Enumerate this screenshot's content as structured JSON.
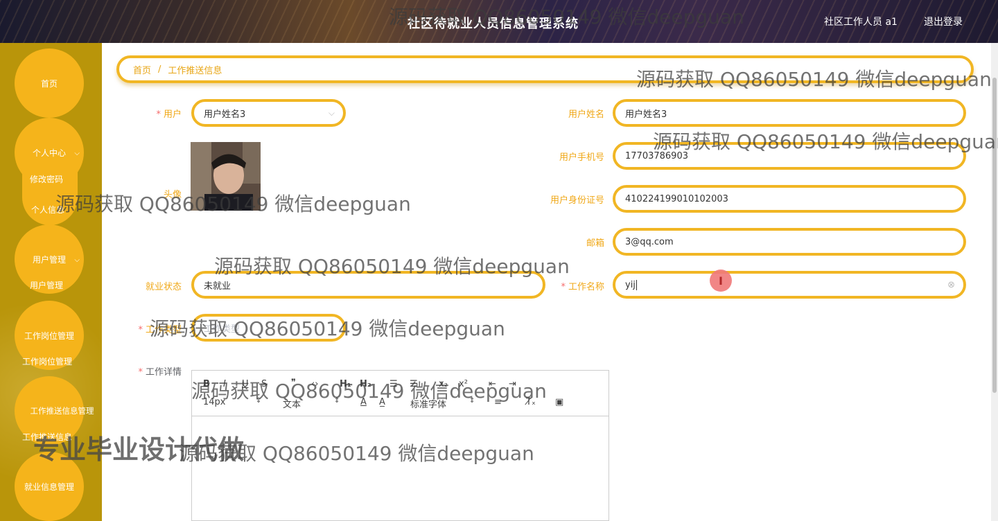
{
  "header": {
    "title": "社区待就业人员信息管理系统",
    "user": "社区工作人员 a1",
    "logout": "退出登录"
  },
  "sidebar": {
    "home": "首页",
    "personal_center": "个人中心",
    "change_password": "修改密码",
    "personal_info": "个人信息",
    "user_mgmt": "用户管理",
    "user_mgmt_sub": "用户管理",
    "job_post_mgmt": "工作岗位管理",
    "job_post_mgmt_sub": "工作岗位管理",
    "job_push_mgmt": "工作推送信息管理",
    "job_push_mgmt_sub": "工作推送信息",
    "employment_mgmt": "就业信息管理"
  },
  "breadcrumb": {
    "home": "首页",
    "sep": "/",
    "current": "工作推送信息"
  },
  "form": {
    "user_label": "用户",
    "user_value": "用户姓名3",
    "avatar_label": "头像",
    "user_name_label": "用户姓名",
    "user_name_value": "用户姓名3",
    "phone_label": "用户手机号",
    "phone_value": "17703786903",
    "id_label": "用户身份证号",
    "id_value": "410224199010102003",
    "email_label": "邮箱",
    "email_value": "3@qq.com",
    "emp_status_label": "就业状态",
    "emp_status_value": "未就业",
    "job_name_label": "工作名称",
    "job_name_value": "yij",
    "job_type_label": "工作类型",
    "job_type_placeholder": "工作类型",
    "job_detail_label": "工作详情"
  },
  "editor": {
    "font_size": "14px",
    "block_type": "文本",
    "font_family": "标准字体"
  },
  "watermarks": {
    "wm": "源码获取 QQ86050149 微信deepguan",
    "big": "专业毕业设计代做"
  }
}
